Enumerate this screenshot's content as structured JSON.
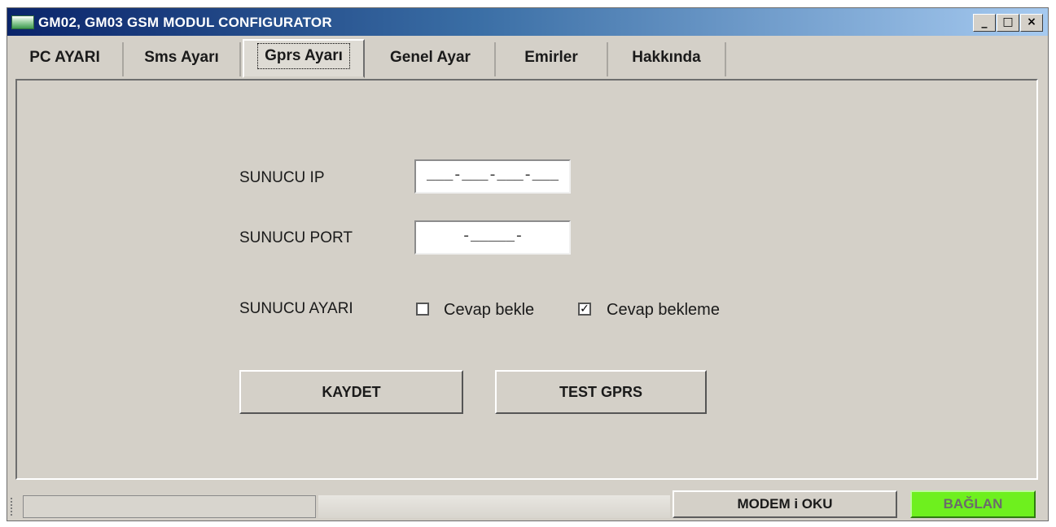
{
  "window": {
    "title": "GM02, GM03 GSM MODUL CONFIGURATOR",
    "controls": {
      "minimize": "_",
      "maximize": "□",
      "close": "×"
    }
  },
  "tabs": [
    {
      "label": "PC AYARI",
      "active": false
    },
    {
      "label": "Sms Ayarı",
      "active": false
    },
    {
      "label": "Gprs Ayarı",
      "active": true
    },
    {
      "label": "Genel Ayar",
      "active": false
    },
    {
      "label": "Emirler",
      "active": false
    },
    {
      "label": "Hakkında",
      "active": false
    }
  ],
  "form": {
    "server_ip_label": "SUNUCU IP",
    "server_ip_value": "___-___-___-___",
    "server_port_label": "SUNUCU PORT",
    "server_port_value": "-_____-",
    "server_setting_label": "SUNUCU AYARI",
    "option_wait_label": "Cevap bekle",
    "option_wait_checked": false,
    "option_nowait_label": "Cevap bekleme",
    "option_nowait_checked": true,
    "save_button": "KAYDET",
    "test_button": "TEST GPRS"
  },
  "statusbar": {
    "status_text": "",
    "modem_button": "MODEM i OKU",
    "connect_button": "BAĞLAN",
    "connect_color": "#6ef01e"
  }
}
